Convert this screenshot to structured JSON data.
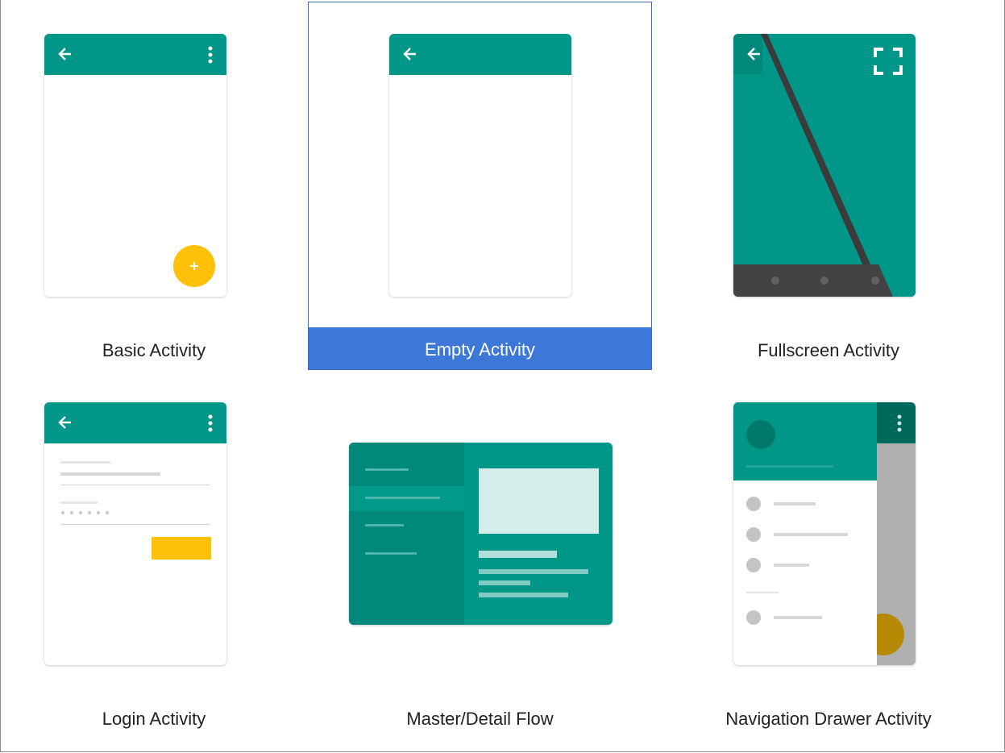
{
  "templates": [
    {
      "label": "Basic Activity"
    },
    {
      "label": "Empty Activity",
      "selected": true
    },
    {
      "label": "Fullscreen Activity"
    },
    {
      "label": "Login Activity"
    },
    {
      "label": "Master/Detail Flow"
    },
    {
      "label": "Navigation Drawer Activity"
    }
  ],
  "colors": {
    "teal": "#009688",
    "dark_teal": "#00796b",
    "amber": "#ffc107",
    "selection": "#3d78d8"
  },
  "icons": {
    "back": "arrow-left-icon",
    "overflow": "more-vert-icon",
    "fab": "plus-icon",
    "fullscreen": "fullscreen-icon"
  }
}
